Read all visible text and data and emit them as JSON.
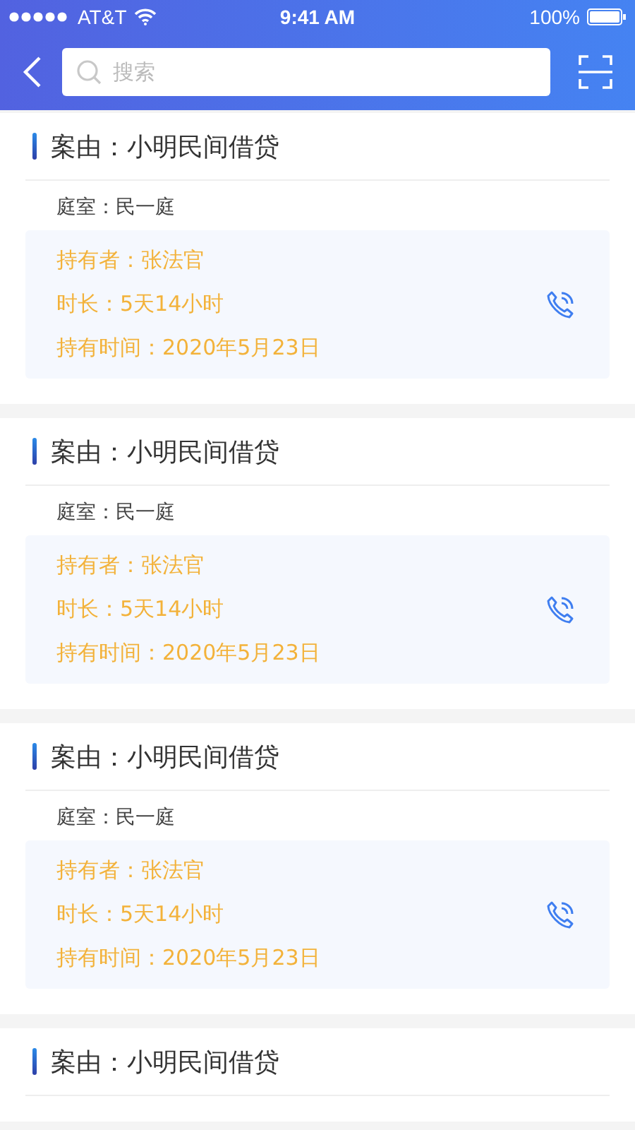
{
  "status_bar": {
    "carrier": "AT&T",
    "time": "9:41 AM",
    "battery": "100%"
  },
  "search": {
    "placeholder": "搜索"
  },
  "cases": [
    {
      "title": "案由：小明民间借贷",
      "room": "庭室：民一庭",
      "holder": "持有者：张法官",
      "duration": "时长：5天14小时",
      "held_since": "持有时间：2020年5月23日"
    },
    {
      "title": "案由：小明民间借贷",
      "room": "庭室：民一庭",
      "holder": "持有者：张法官",
      "duration": "时长：5天14小时",
      "held_since": "持有时间：2020年5月23日"
    },
    {
      "title": "案由：小明民间借贷",
      "room": "庭室：民一庭",
      "holder": "持有者：张法官",
      "duration": "时长：5天14小时",
      "held_since": "持有时间：2020年5月23日"
    },
    {
      "title": "案由：小明民间借贷"
    }
  ]
}
